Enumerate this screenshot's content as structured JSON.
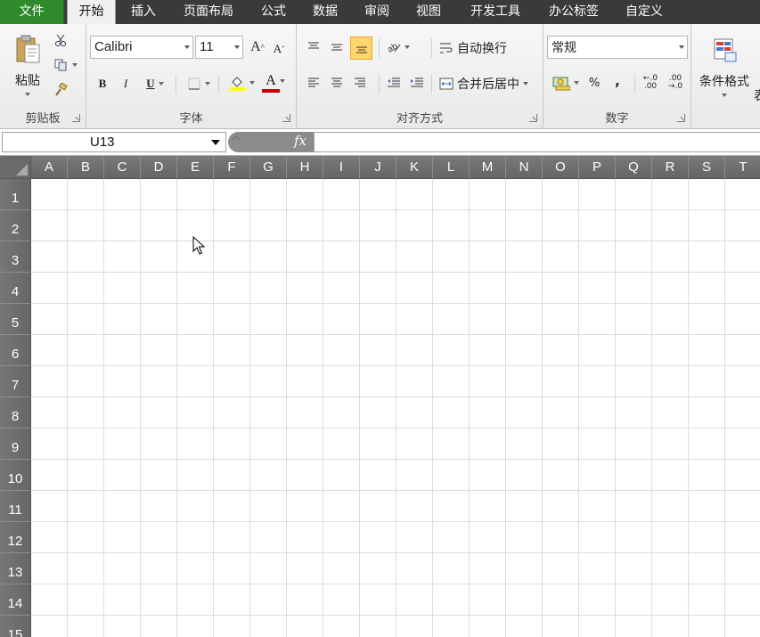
{
  "tabs": [
    {
      "label": "文件",
      "kind": "file"
    },
    {
      "label": "开始",
      "kind": "active"
    },
    {
      "label": "插入"
    },
    {
      "label": "页面布局"
    },
    {
      "label": "公式"
    },
    {
      "label": "数据"
    },
    {
      "label": "审阅"
    },
    {
      "label": "视图"
    },
    {
      "label": "开发工具"
    },
    {
      "label": "办公标签"
    },
    {
      "label": "自定义"
    }
  ],
  "ribbon": {
    "clipboard": {
      "paste_label": "粘贴",
      "group_label": "剪贴板"
    },
    "font": {
      "font_name": "Calibri",
      "font_size": "11",
      "grow_label": "A",
      "shrink_label": "A",
      "bold_label": "B",
      "italic_label": "I",
      "underline_label": "U",
      "font_color_label": "A",
      "group_label": "字体",
      "highlight_color": "#ffff00",
      "font_color": "#c00000"
    },
    "alignment": {
      "wrap_label": "自动换行",
      "merge_label": "合并后居中",
      "group_label": "对齐方式"
    },
    "number": {
      "format_value": "常规",
      "percent_label": "%",
      "comma_label": ",",
      "inc_decimal_label": ".0",
      "dec_decimal_label": ".00",
      "group_label": "数字"
    },
    "styles": {
      "conditional_label": "条件格式",
      "partial_label": "表"
    }
  },
  "formula_bar": {
    "name_box": "U13",
    "fx_label": "fx",
    "formula": ""
  },
  "sheet": {
    "columns": [
      "A",
      "B",
      "C",
      "D",
      "E",
      "F",
      "G",
      "H",
      "I",
      "J",
      "K",
      "L",
      "M",
      "N",
      "O",
      "P",
      "Q",
      "R",
      "S",
      "T"
    ],
    "rows": [
      "1",
      "2",
      "3",
      "4",
      "5",
      "6",
      "7",
      "8",
      "9",
      "10",
      "11",
      "12",
      "13",
      "14",
      "15"
    ]
  },
  "colors": {
    "file_tab": "#2f8a2c",
    "tab_bar": "#3a3a3a",
    "header_bg": "#6a6a6a",
    "active_align_button": "#ffd66b"
  }
}
